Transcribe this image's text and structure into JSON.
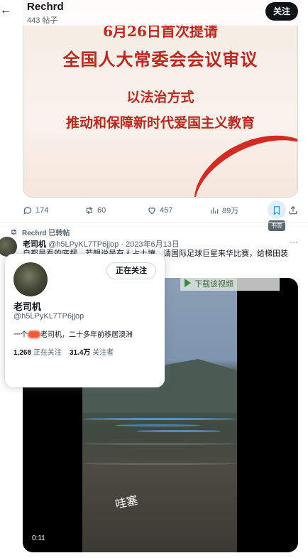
{
  "header": {
    "back_icon": "arrow-left-icon",
    "name": "Rechrd",
    "post_count": "443 帖子",
    "follow_label": "关注"
  },
  "image_post": {
    "line1": "6月26日首次提请",
    "line2": "全国人大常委会会议审议",
    "line3": "以法治方式",
    "line4": "推动和保障新时代爱国主义教育",
    "accent": "#c0261e"
  },
  "actions": {
    "replies": "174",
    "reposts": "60",
    "likes": "457",
    "views": "89万",
    "bookmark_tooltip": "书签"
  },
  "repost": {
    "label": "Rechrd 已转帖",
    "author_name": "老司机",
    "author_handle": "@h5LPyKL7TP6jjop",
    "date": "· 2023年6月13日",
    "more_label": "···",
    "text": "自都是看的底摆，若想说是有人占土壤，请国际足球巨星来华比赛，给梯田装"
  },
  "video": {
    "watermark": "下载该视频",
    "caption": "哇塞",
    "duration": "0:11"
  },
  "hover_card": {
    "follow_label": "正在关注",
    "name": "老司机",
    "handle": "@h5LPyKL7TP6jjop",
    "bio_before": "一个",
    "bio_after": "老司机，二十多年前移居澳洲",
    "following_count": "1,268",
    "following_label": "正在关注",
    "followers_count": "31.4万",
    "followers_label": "关注者"
  },
  "colors": {
    "brand_blue": "#1d9bf0",
    "text_secondary": "#536471"
  }
}
